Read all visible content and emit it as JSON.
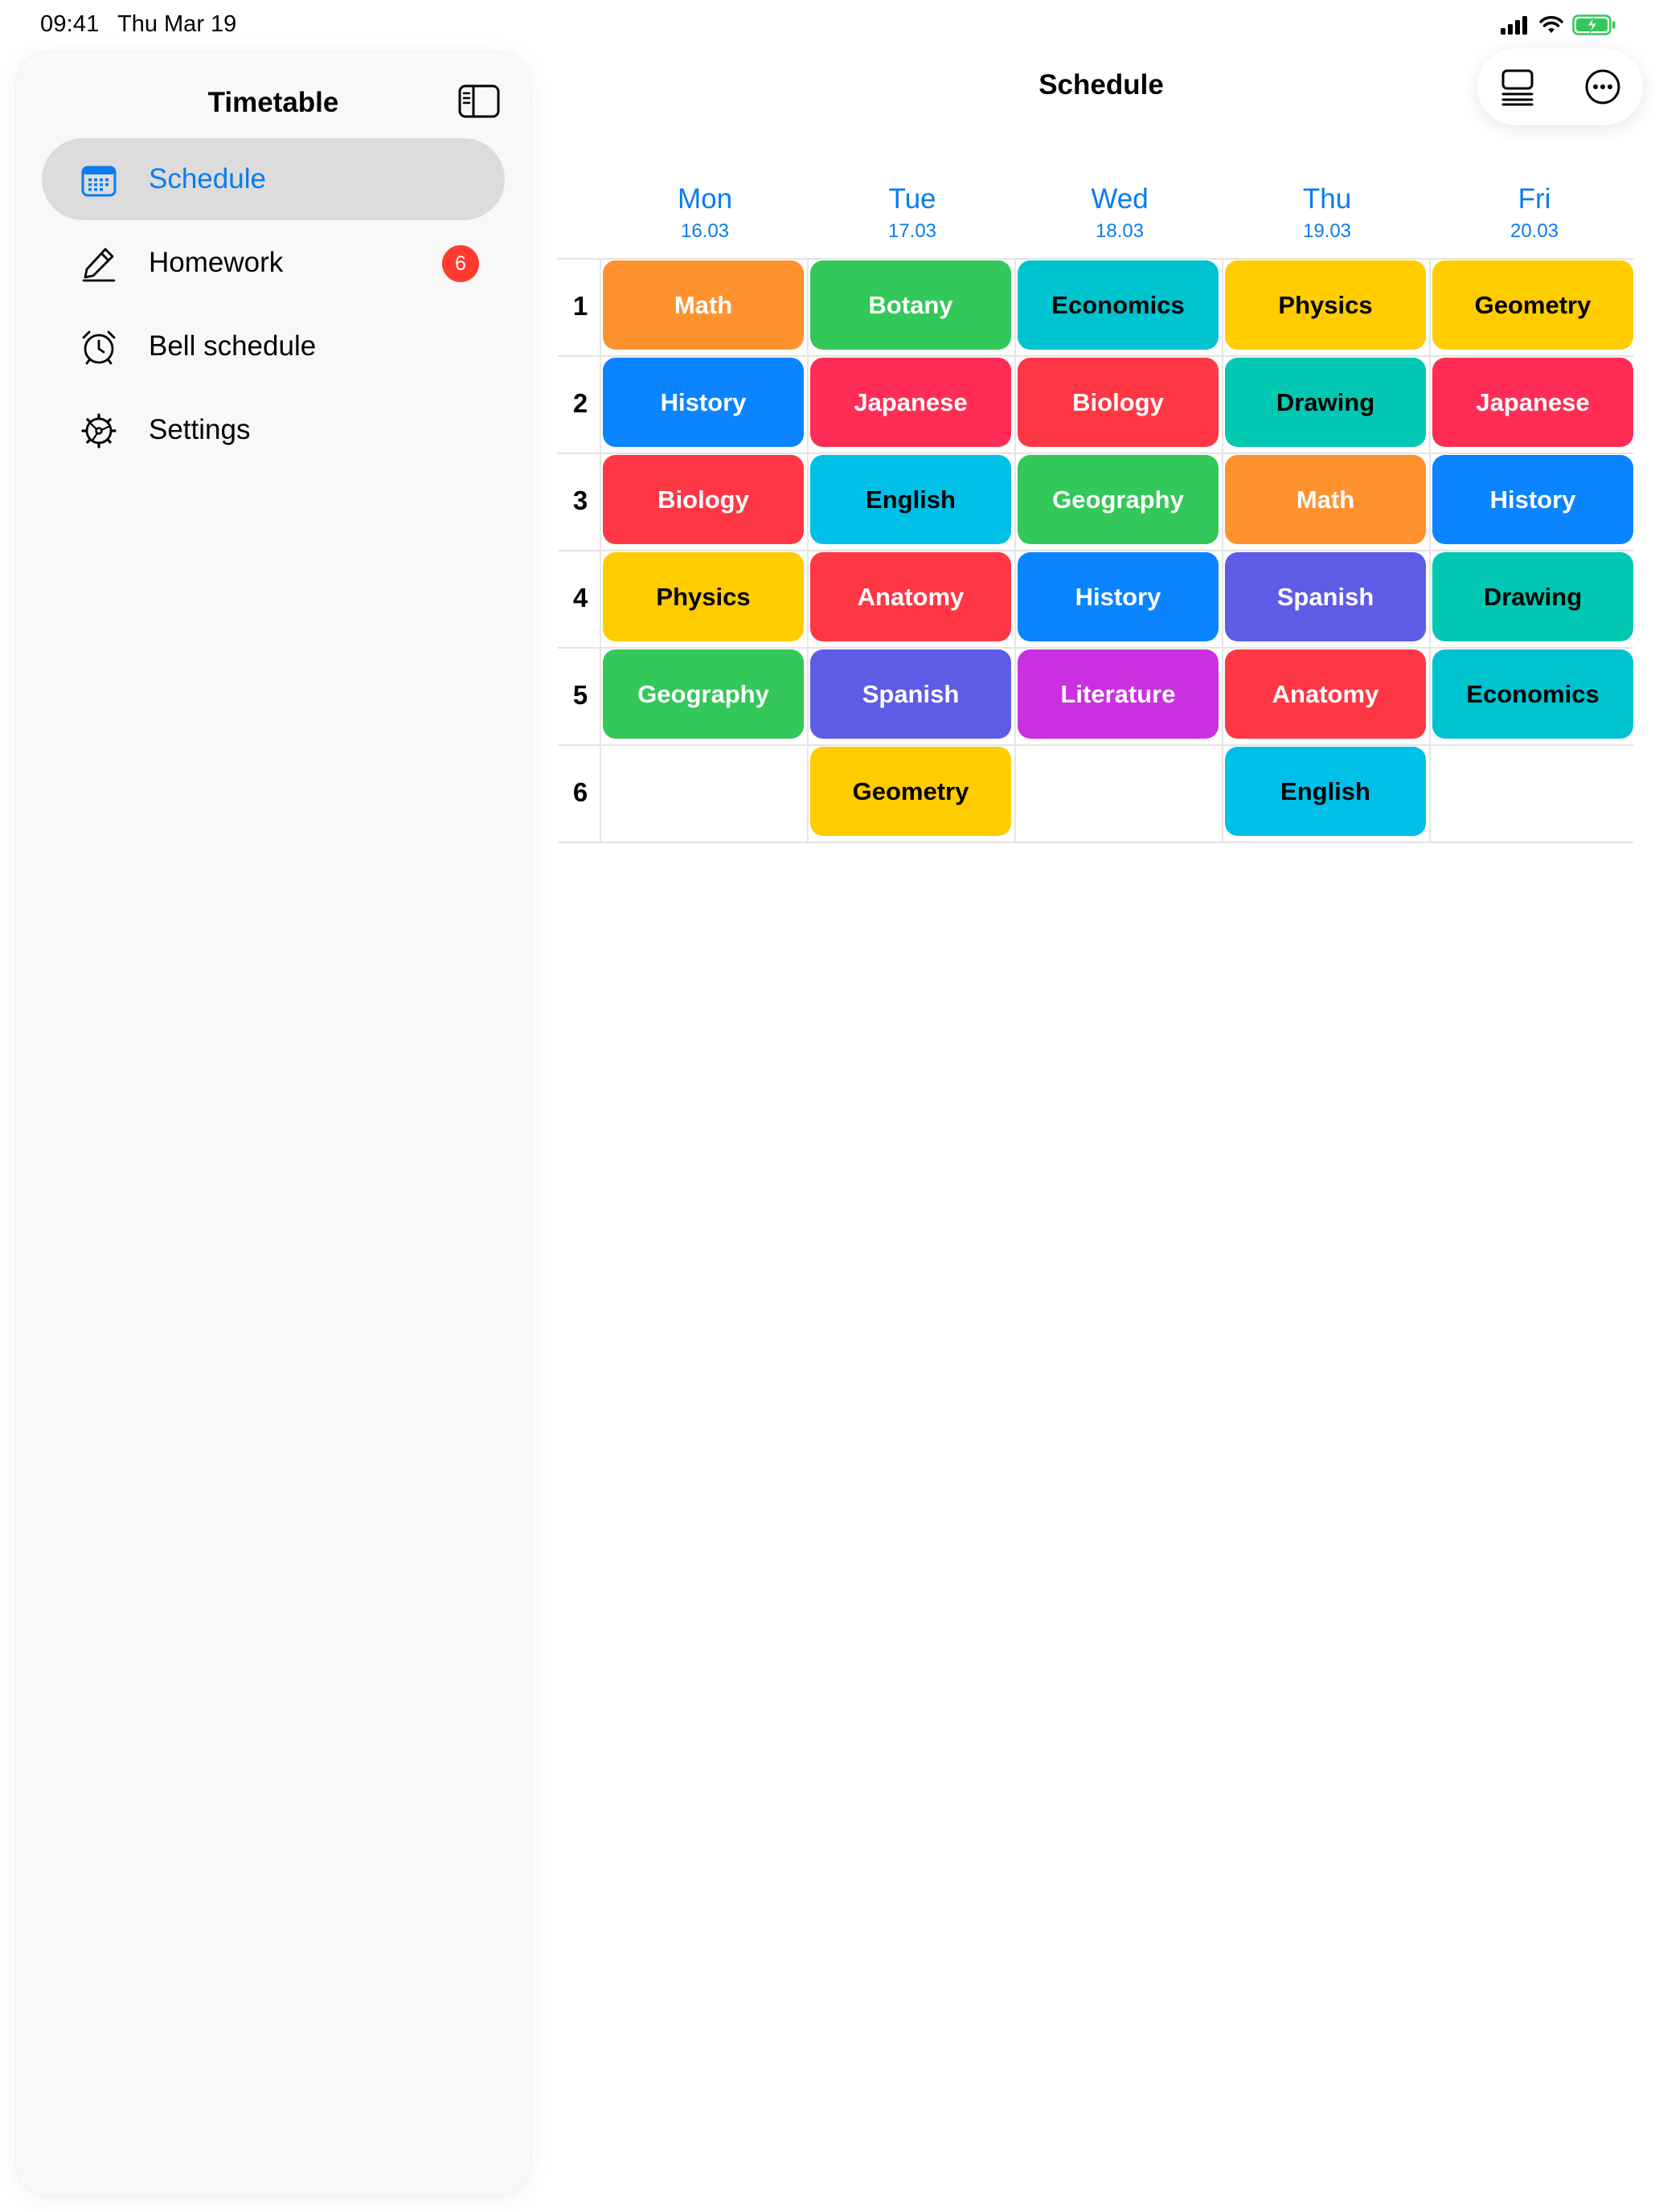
{
  "status_bar": {
    "time": "09:41",
    "date": "Thu Mar 19"
  },
  "sidebar": {
    "title": "Timetable",
    "items": [
      {
        "label": "Schedule",
        "icon": "calendar-icon",
        "active": true
      },
      {
        "label": "Homework",
        "icon": "pencil-icon",
        "badge": "6"
      },
      {
        "label": "Bell schedule",
        "icon": "alarm-clock-icon"
      },
      {
        "label": "Settings",
        "icon": "gear-icon"
      }
    ]
  },
  "header": {
    "title": "Schedule"
  },
  "timetable": {
    "days": [
      {
        "name": "Mon",
        "date": "16.03"
      },
      {
        "name": "Tue",
        "date": "17.03"
      },
      {
        "name": "Wed",
        "date": "18.03"
      },
      {
        "name": "Thu",
        "date": "19.03"
      },
      {
        "name": "Fri",
        "date": "20.03"
      }
    ],
    "periods": [
      "1",
      "2",
      "3",
      "4",
      "5",
      "6"
    ],
    "lessons": [
      [
        {
          "subject": "Math",
          "color": "#fe922f",
          "text": "light"
        },
        {
          "subject": "History",
          "color": "#0a84ff",
          "text": "light"
        },
        {
          "subject": "Biology",
          "color": "#ff3745",
          "text": "light"
        },
        {
          "subject": "Physics",
          "color": "#ffcc00",
          "text": "dark"
        },
        {
          "subject": "Geography",
          "color": "#34c759",
          "text": "light"
        },
        null
      ],
      [
        {
          "subject": "Botany",
          "color": "#34c759",
          "text": "light"
        },
        {
          "subject": "Japanese",
          "color": "#ff2d55",
          "text": "light"
        },
        {
          "subject": "English",
          "color": "#00c0e8",
          "text": "dark"
        },
        {
          "subject": "Anatomy",
          "color": "#ff3745",
          "text": "light"
        },
        {
          "subject": "Spanish",
          "color": "#5e5ce6",
          "text": "light"
        },
        {
          "subject": "Geometry",
          "color": "#ffcc00",
          "text": "dark"
        }
      ],
      [
        {
          "subject": "Economics",
          "color": "#00c3d0",
          "text": "dark"
        },
        {
          "subject": "Biology",
          "color": "#ff3745",
          "text": "light"
        },
        {
          "subject": "Geography",
          "color": "#34c759",
          "text": "light"
        },
        {
          "subject": "History",
          "color": "#0a84ff",
          "text": "light"
        },
        {
          "subject": "Literature",
          "color": "#cb30e0",
          "text": "light"
        },
        null
      ],
      [
        {
          "subject": "Physics",
          "color": "#ffcc00",
          "text": "dark"
        },
        {
          "subject": "Drawing",
          "color": "#00c8b3",
          "text": "dark"
        },
        {
          "subject": "Math",
          "color": "#fe922f",
          "text": "light"
        },
        {
          "subject": "Spanish",
          "color": "#5e5ce6",
          "text": "light"
        },
        {
          "subject": "Anatomy",
          "color": "#ff3745",
          "text": "light"
        },
        {
          "subject": "English",
          "color": "#00c0e8",
          "text": "dark"
        }
      ],
      [
        {
          "subject": "Geometry",
          "color": "#ffcc00",
          "text": "dark"
        },
        {
          "subject": "Japanese",
          "color": "#ff2d55",
          "text": "light"
        },
        {
          "subject": "History",
          "color": "#0a84ff",
          "text": "light"
        },
        {
          "subject": "Drawing",
          "color": "#00c8b3",
          "text": "dark"
        },
        {
          "subject": "Economics",
          "color": "#00c3d0",
          "text": "dark"
        },
        null
      ]
    ]
  },
  "colors": {
    "accent": "#0a7cf0",
    "badge": "#ff3b30"
  }
}
